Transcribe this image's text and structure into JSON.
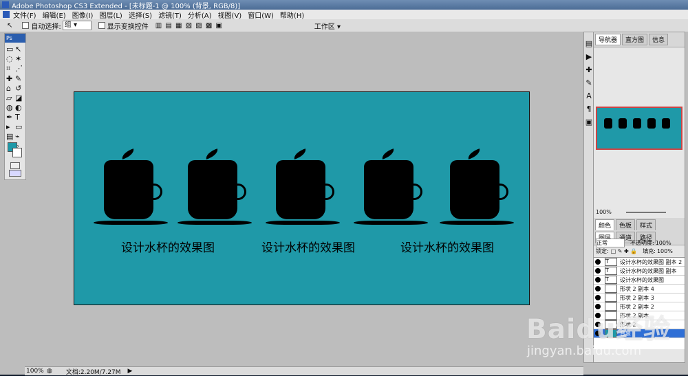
{
  "window": {
    "title": "Adobe Photoshop CS3 Extended - [未标题-1 @ 100% (背景, RGB/8)]"
  },
  "menus": [
    "文件(F)",
    "编辑(E)",
    "图像(I)",
    "图层(L)",
    "选择(S)",
    "滤镜(T)",
    "分析(A)",
    "视图(V)",
    "窗口(W)",
    "帮助(H)"
  ],
  "options": {
    "auto_select_label": "自动选择:",
    "auto_select_value": "组",
    "show_transform_label": "显示变换控件",
    "workspace_label": "工作区 ▾"
  },
  "canvas": {
    "captions": [
      "设计水杯的效果图",
      "设计水杯的效果图",
      "设计水杯的效果图"
    ]
  },
  "navigator": {
    "tabs": [
      "导航器",
      "直方图",
      "信息"
    ],
    "zoom": "100%"
  },
  "color_panel": {
    "tabs": [
      "颜色",
      "色板",
      "样式"
    ]
  },
  "layers_panel": {
    "tabs": [
      "图层",
      "通道",
      "路径"
    ],
    "blend_mode": "正常",
    "opacity_label": "不透明度:",
    "opacity_value": "100%",
    "lock_label": "锁定:",
    "fill_label": "填充:",
    "fill_value": "100%",
    "layers": [
      "设计水杯的效果图 副本 2",
      "设计水杯的效果图 副本",
      "设计水杯的效果图",
      "形状 2 副本 4",
      "形状 2 副本 3",
      "形状 2 副本 2",
      "形状 2 副本",
      "形状 2",
      "背景"
    ]
  },
  "status": {
    "zoom": "100%",
    "doc": "文档:2.20M/7.27M"
  },
  "watermark": {
    "logo": "Baidu经验",
    "url": "jingyan.baidu.com"
  }
}
